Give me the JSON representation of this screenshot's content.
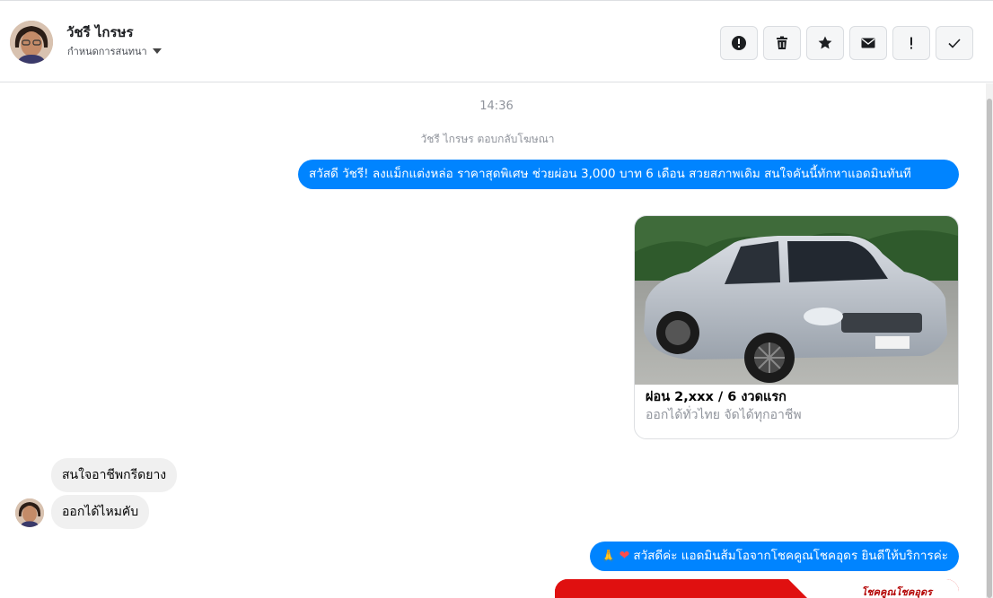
{
  "header": {
    "contact_name": "วัชรี ไกรษร",
    "conversation_settings": "กำหนดการสนทนา",
    "toolbar": [
      {
        "icon": "alert-circle-icon"
      },
      {
        "icon": "trash-icon"
      },
      {
        "icon": "star-icon"
      },
      {
        "icon": "envelope-icon"
      },
      {
        "icon": "exclamation-icon"
      },
      {
        "icon": "check-icon"
      }
    ]
  },
  "chat": {
    "timestamp": "14:36",
    "reply_note": "วัชรี ไกรษร ตอบกลับโฆษณา",
    "messages": {
      "out1": "สวัสดี วัชรี! ลงแม็กแต่งหล่อ ราคาสุดพิเศษ ช่วยผ่อน 3,000 บาท 6 เดือน สวยสภาพเดิม สนใจคันนี้ทักหาแอดมินทันที",
      "card_title": "ผ่อน 2,xxx / 6 งวดแรก",
      "card_subtitle": "ออกได้ทั่วไทย จัดได้ทุกอาชีพ",
      "in1": "สนใจอาชีพกรีดยาง",
      "in2": "ออกได้ไหมคับ",
      "out2": "สวัสดีค่ะ แอดมินส้มโอจากโชคคูณโชคอุดร ยินดีให้บริการค่ะ",
      "banner_text": "โชคคูณโชคอุดร"
    }
  },
  "colors": {
    "outgoing_bubble": "#0084ff",
    "incoming_bubble": "#f0f0f0",
    "banner_red": "#e01010"
  }
}
